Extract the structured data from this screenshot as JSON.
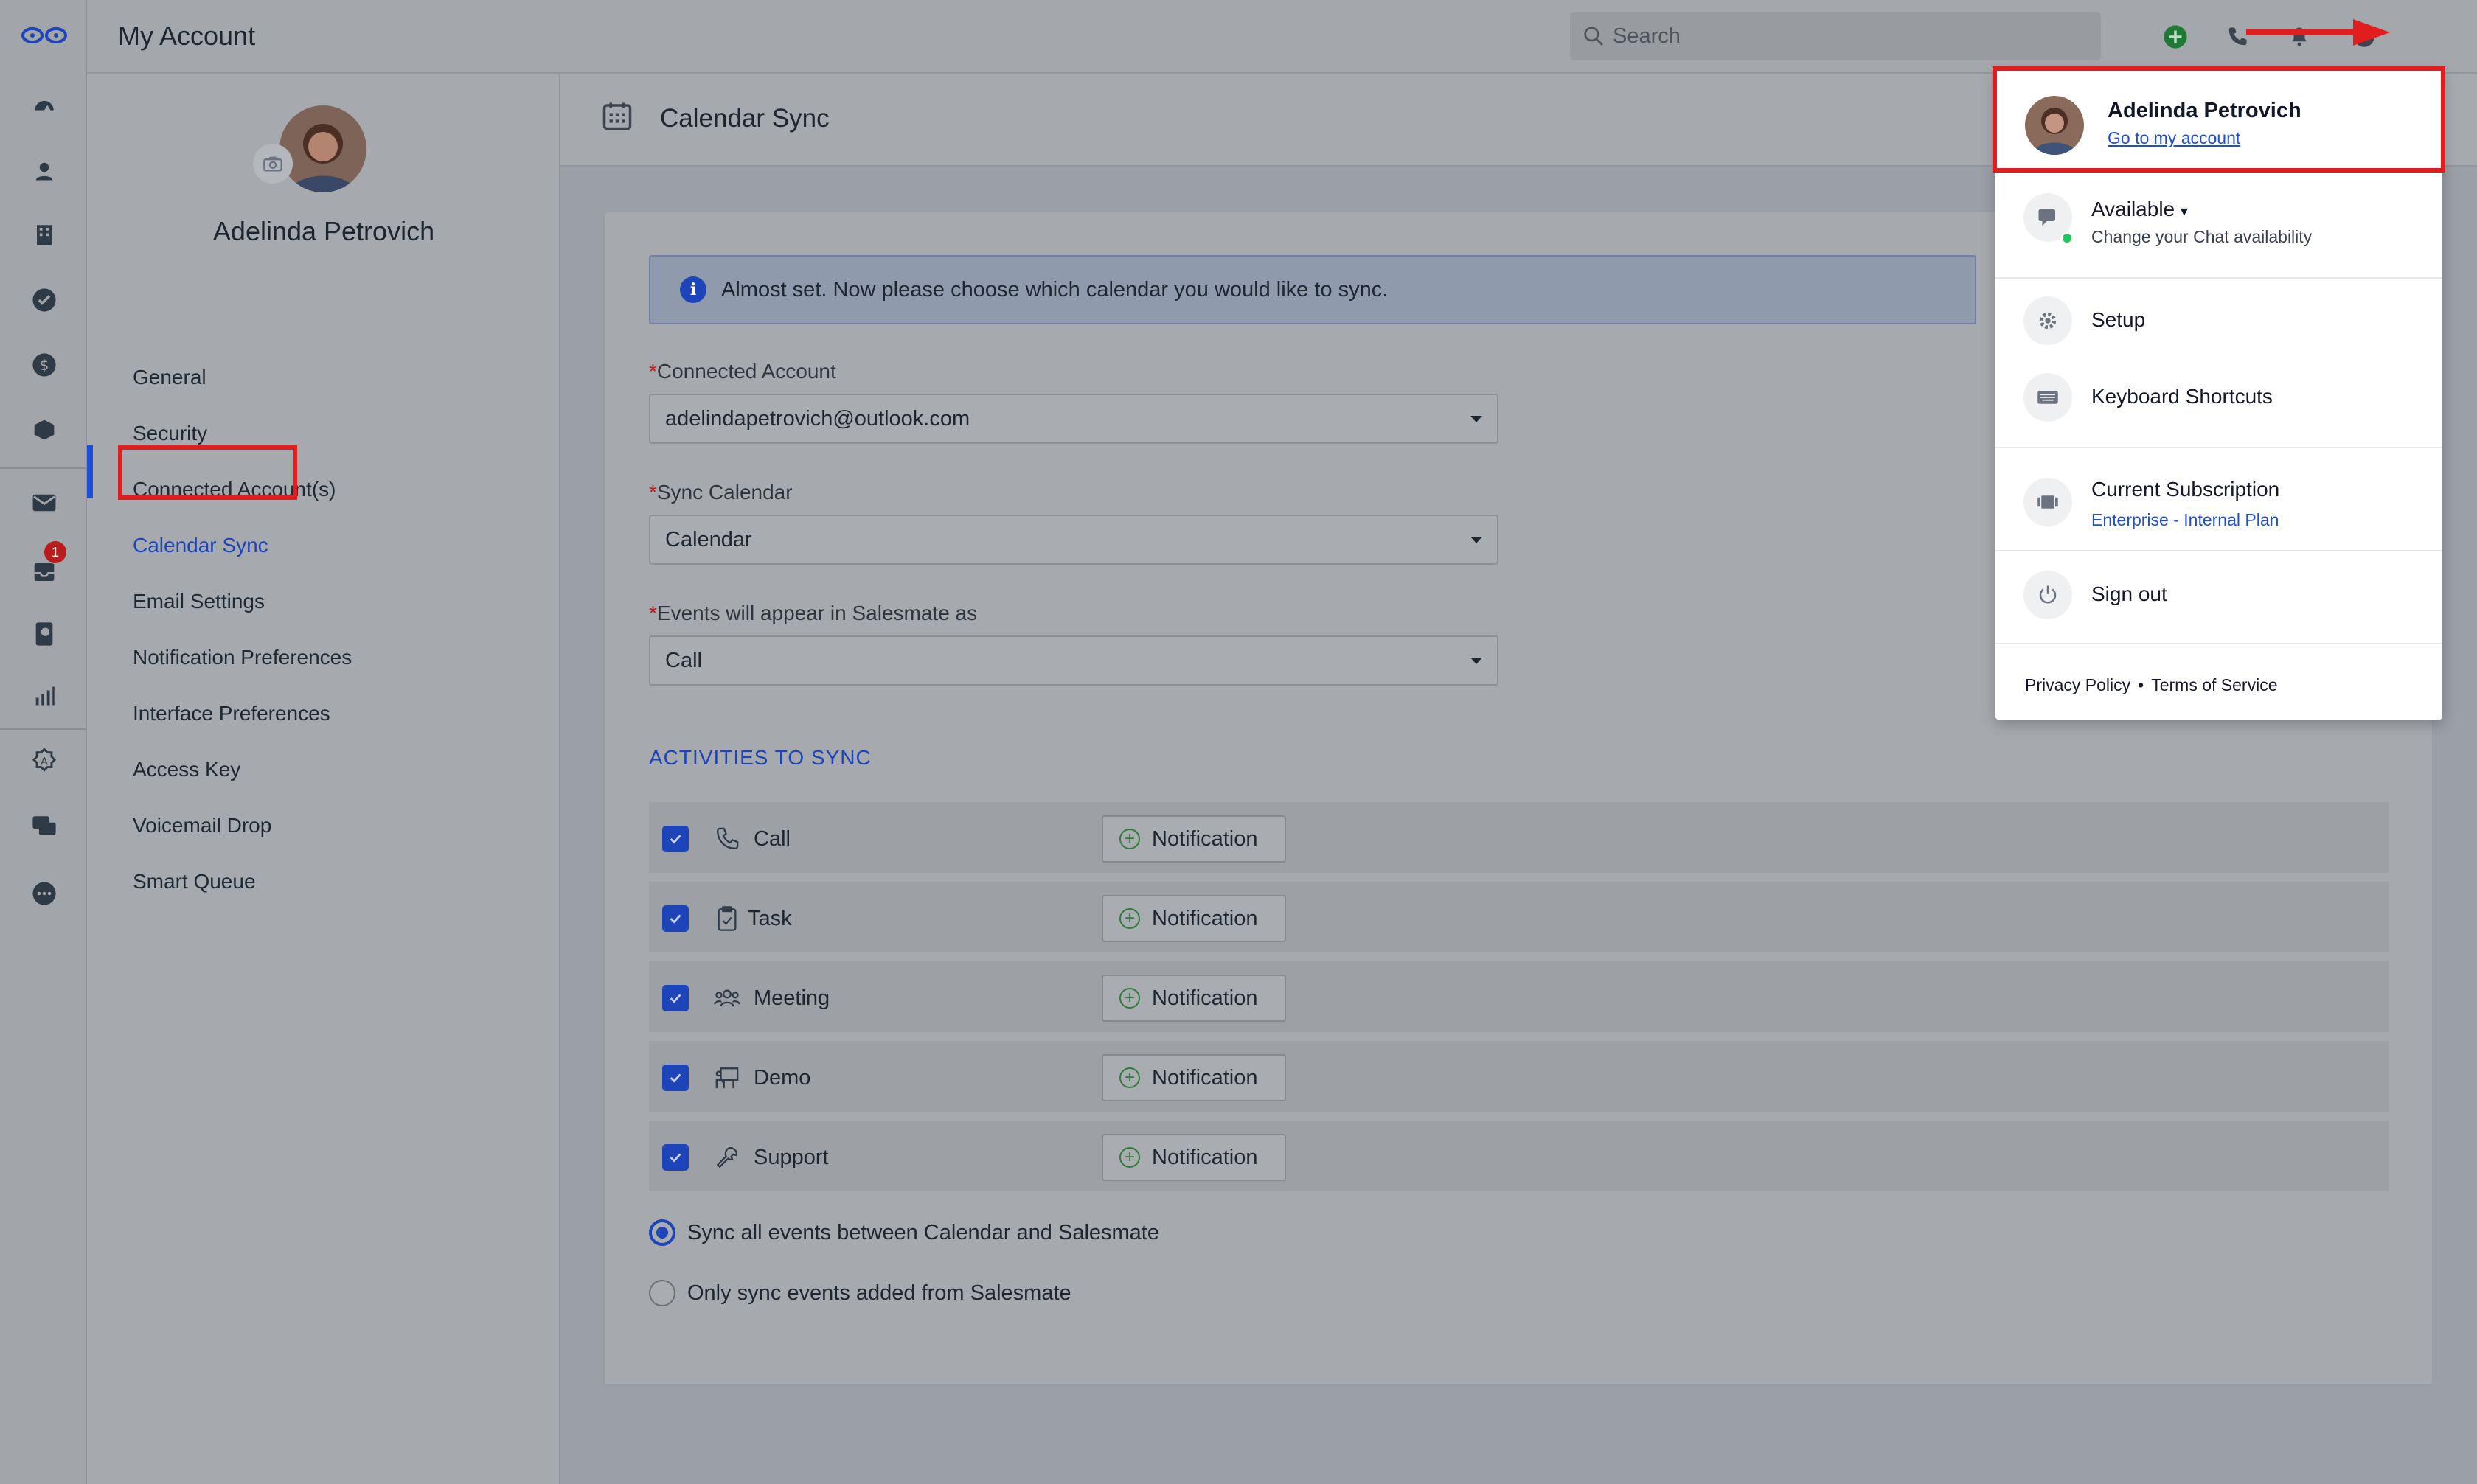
{
  "app": {
    "title": "My Account",
    "search_placeholder": "Search",
    "notification_badge": "1"
  },
  "sidebar": {
    "user_name": "Adelinda Petrovich",
    "items": [
      {
        "label": "General"
      },
      {
        "label": "Security"
      },
      {
        "label": "Connected Account(s)"
      },
      {
        "label": "Calendar Sync"
      },
      {
        "label": "Email Settings"
      },
      {
        "label": "Notification Preferences"
      },
      {
        "label": "Interface Preferences"
      },
      {
        "label": "Access Key"
      },
      {
        "label": "Voicemail Drop"
      },
      {
        "label": "Smart Queue"
      }
    ],
    "active_item": "Calendar Sync"
  },
  "main": {
    "title": "Calendar Sync",
    "alert": "Almost set. Now please choose which calendar you would like to sync.",
    "fields": [
      {
        "label": "Connected Account",
        "value": "adelindapetrovich@outlook.com"
      },
      {
        "label": "Sync Calendar",
        "value": "Calendar"
      },
      {
        "label": "Events will appear in Salesmate as",
        "value": "Call"
      }
    ],
    "required_marker": "*",
    "activities_title": "ACTIVITIES TO SYNC",
    "activities": [
      {
        "label": "Call",
        "icon": "phone-icon",
        "checked": true,
        "button": "Notification"
      },
      {
        "label": "Task",
        "icon": "clipboard-icon",
        "checked": true,
        "button": "Notification"
      },
      {
        "label": "Meeting",
        "icon": "people-icon",
        "checked": true,
        "button": "Notification"
      },
      {
        "label": "Demo",
        "icon": "presentation-icon",
        "checked": true,
        "button": "Notification"
      },
      {
        "label": "Support",
        "icon": "wrench-icon",
        "checked": true,
        "button": "Notification"
      }
    ],
    "sync_options": [
      {
        "label": "Sync all events between Calendar and Salesmate",
        "selected": true
      },
      {
        "label": "Only sync events added from Salesmate",
        "selected": false
      }
    ]
  },
  "dropdown": {
    "user_name": "Adelinda Petrovich",
    "account_link": "Go to my account",
    "status": "Available",
    "status_sub": "Change your Chat availability",
    "setup": "Setup",
    "shortcuts": "Keyboard Shortcuts",
    "subscription": "Current Subscription",
    "plan": "Enterprise - Internal Plan",
    "sign_out": "Sign out",
    "privacy": "Privacy Policy",
    "terms": "Terms of Service"
  },
  "colors": {
    "accent": "#1d44b8",
    "highlight": "#e11d1d",
    "online": "#22c55e"
  }
}
